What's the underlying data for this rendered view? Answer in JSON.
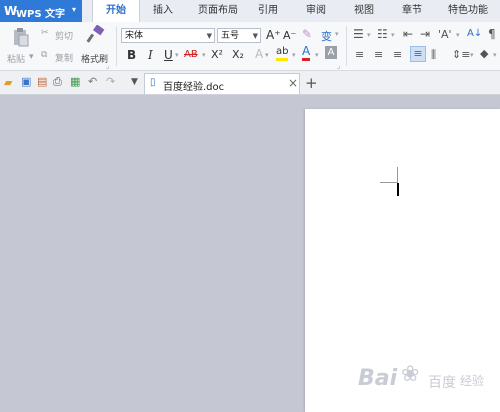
{
  "app": {
    "logo_letter": "W",
    "title": "WPS 文字",
    "menu_arrow": "▾"
  },
  "ribbon_tabs": [
    "开始",
    "插入",
    "页面布局",
    "引用",
    "审阅",
    "视图",
    "章节",
    "特色功能"
  ],
  "ribbon": {
    "paste_label": "粘贴",
    "cut_label": "剪切",
    "copy_label": "复制",
    "format_painter_label": "格式刷",
    "font_name": "宋体",
    "font_size": "五号",
    "bold": "B",
    "italic": "I",
    "underline": "U",
    "strikethrough": "AB",
    "superscript": "X²",
    "subscript": "X₂",
    "grow_font": "A⁺",
    "shrink_font": "A⁻",
    "font_color_letter": "A",
    "char_shading_letter": "A",
    "highlight_letter": "ab",
    "text_effect_letter": "A",
    "pinyin_letter": "变",
    "sort_letter": "A↓",
    "colors": {
      "highlight": "#ffe600",
      "font_color": "#e02020",
      "accent": "#2b6fc8"
    }
  },
  "document": {
    "tab_title": "百度经验.doc",
    "close": "×",
    "new_tab": "+",
    "nav_arrow": "▼"
  },
  "watermark": {
    "brand": "Bai",
    "brand2": "百度",
    "sub": "经验"
  }
}
